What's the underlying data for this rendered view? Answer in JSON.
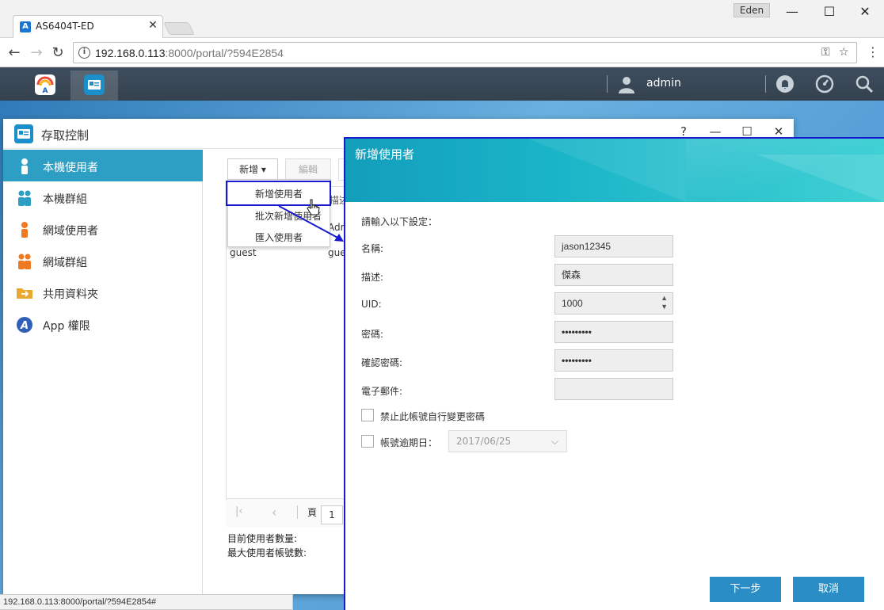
{
  "browser": {
    "tab_title": "AS6404T-ED",
    "tab_close": "✕",
    "profile": "Eden",
    "url_host": "192.168.0.113",
    "url_rest": ":8000/portal/?594E2854",
    "status_url": "192.168.0.113:8000/portal/?594E2854#",
    "nav": {
      "back": "←",
      "forward": "→",
      "reload": "↻"
    },
    "win": {
      "min": "—",
      "max": "☐",
      "close": "✕"
    }
  },
  "adm": {
    "user": "admin",
    "apps": [
      "app-central-icon",
      "access-control-icon"
    ],
    "icons": [
      "notification-icon",
      "dashboard-icon",
      "search-icon"
    ]
  },
  "access_control": {
    "title": "存取控制",
    "controls": {
      "help": "?",
      "min": "—",
      "max": "☐",
      "close": "✕"
    },
    "sidebar": [
      {
        "label": "本機使用者",
        "icon": "local-user-icon",
        "active": true
      },
      {
        "label": "本機群組",
        "icon": "local-group-icon",
        "active": false
      },
      {
        "label": "網域使用者",
        "icon": "domain-user-icon",
        "active": false
      },
      {
        "label": "網域群組",
        "icon": "domain-group-icon",
        "active": false
      },
      {
        "label": "共用資料夾",
        "icon": "shared-folder-icon",
        "active": false
      },
      {
        "label": "App 權限",
        "icon": "app-permission-icon",
        "active": false
      }
    ],
    "toolbar": {
      "add": "新增 ▾",
      "edit": "編輯"
    },
    "add_menu": [
      "新增使用者",
      "批次新增使用者",
      "匯入使用者"
    ],
    "grid": {
      "head_partial": "描述",
      "row_partial": "Adm",
      "guest_name": "guest",
      "guest_desc": "gue"
    },
    "pager": {
      "first": "|‹",
      "prev": "‹",
      "page_label": "頁",
      "page": "1"
    },
    "footer": {
      "current_count": "目前使用者數量:",
      "max_count": "最大使用者帳號數:"
    }
  },
  "dialog": {
    "title": "新增使用者",
    "intro": "請輸入以下設定：",
    "fields": {
      "name": {
        "label": "名稱:",
        "value": "jason12345"
      },
      "desc": {
        "label": "描述:",
        "value": "傑森"
      },
      "uid": {
        "label": "UID:",
        "value": "1000"
      },
      "password": {
        "label": "密碼:",
        "value": "•••••••••"
      },
      "confirm": {
        "label": "確認密碼:",
        "value": "•••••••••"
      },
      "email": {
        "label": "電子郵件:",
        "value": ""
      }
    },
    "disallow_change": "禁止此帳號自行變更密碼",
    "expiry": {
      "label": "帳號逾期日：",
      "value": "2017/06/25"
    },
    "buttons": {
      "next": "下一步",
      "cancel": "取消"
    }
  },
  "colors": {
    "accent": "#2e9fc4",
    "dialog_button": "#2a8dc5",
    "highlight": "#1a1acc"
  }
}
